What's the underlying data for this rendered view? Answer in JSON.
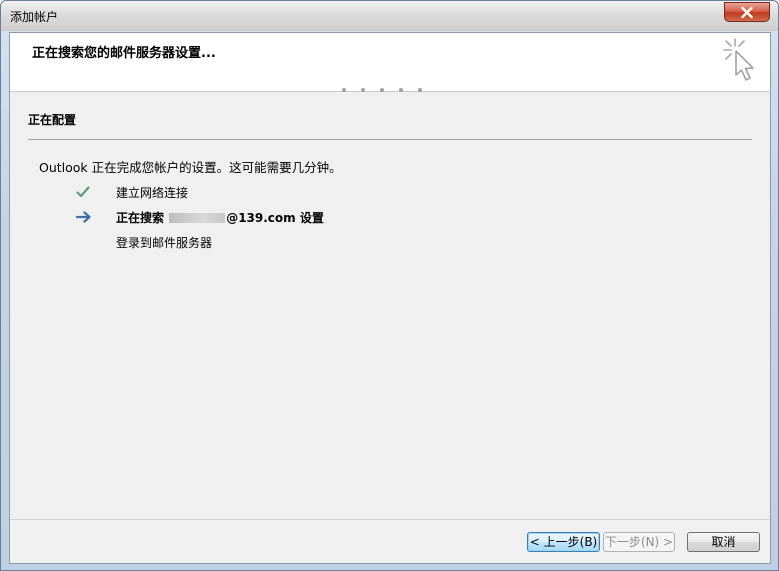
{
  "window": {
    "title": "添加帐户",
    "close_icon": "close-x-icon"
  },
  "header": {
    "title": "正在搜索您的邮件服务器设置...",
    "icon": "wizard-cursor-icon"
  },
  "progress": {
    "dot_count": 5
  },
  "section": {
    "title": "正在配置"
  },
  "status": {
    "text": "Outlook 正在完成您帐户的设置。这可能需要几分钟。"
  },
  "steps": [
    {
      "icon": "checkmark-icon",
      "label": "建立网络连接",
      "bold": false
    },
    {
      "icon": "arrow-right-icon",
      "label_prefix": "正在搜索 ",
      "label_suffix": "@139.com 设置",
      "bold": true
    },
    {
      "icon": "",
      "label": "登录到邮件服务器",
      "bold": false
    }
  ],
  "buttons": {
    "back": "< 上一步(B)",
    "next": "下一步(N) >",
    "cancel": "取消"
  },
  "colors": {
    "check": "#5f9a7c",
    "arrow": "#3b6ea5",
    "close": "#c0391f"
  }
}
